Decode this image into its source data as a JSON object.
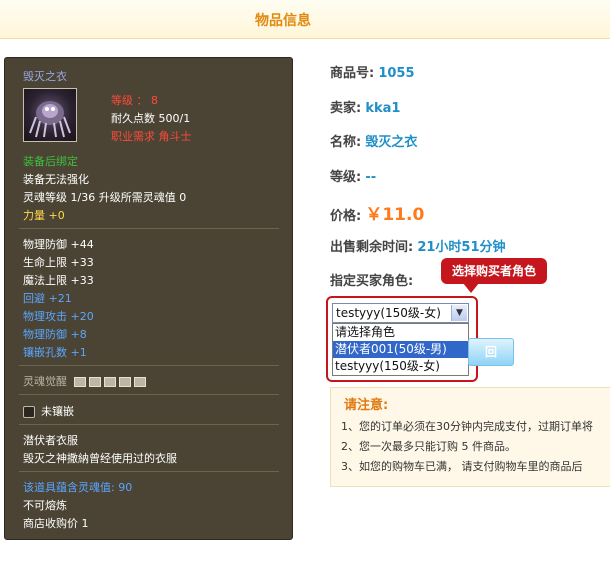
{
  "header": {
    "title": "物品信息"
  },
  "item": {
    "name": "毁灭之衣",
    "level": "等级 ： 8",
    "durability": "耐久点数 500/1",
    "requirement": "职业需求 角斗士",
    "bind": "装备后绑定",
    "no_enhance": "装备无法强化",
    "soul_level": "灵魂等级 1/36 升级所需灵魂值 0",
    "strength": "力量 +0",
    "stats_white": [
      "物理防御 +44",
      "生命上限 +33",
      "魔法上限 +33"
    ],
    "stats_blue": [
      "回避 +21",
      "物理攻击 +20",
      "物理防御 +8",
      "镶嵌孔数 +1"
    ],
    "soul_awaken": "灵魂觉醒",
    "socket": "未镶嵌",
    "desc_title": "潜伏者衣服",
    "desc_text": "毁灭之神撒納曾经使用过的衣服",
    "soul_value": "该道具蕴含灵魂值: 90",
    "no_smelt": "不可熔炼",
    "shop_price": "商店收购价 1"
  },
  "info": {
    "item_no_label": "商品号:",
    "item_no": "1055",
    "seller_label": "卖家:",
    "seller": "kka1",
    "name_label": "名称:",
    "name": "毁灭之衣",
    "level_label": "等级:",
    "level": "--",
    "price_label": "价格:",
    "price": "￥11.0",
    "remain_label": "出售剩余时间:",
    "remain": "21小时51分钟",
    "buyer_label": "指定买家角色:"
  },
  "tooltip": "选择购买者角色",
  "select": {
    "value": "testyyy(150级-女)",
    "options": [
      "请选择角色",
      "潜伏者001(50级-男)",
      "testyyy(150级-女)"
    ],
    "highlighted": 1
  },
  "buy_button": "回",
  "notice": {
    "title": "请注意:",
    "items": [
      "1、您的订单必须在30分钟内完成支付，过期订单将",
      "2、您一次最多只能订购 5 件商品。",
      "3、如您的购物车已满， 请支付购物车里的商品后"
    ]
  },
  "colors": {
    "accent": "#e08a10",
    "price": "#ff7a1a",
    "link": "#1e8fc8",
    "alert": "#c4161c",
    "card_bg": "#4b4434"
  }
}
